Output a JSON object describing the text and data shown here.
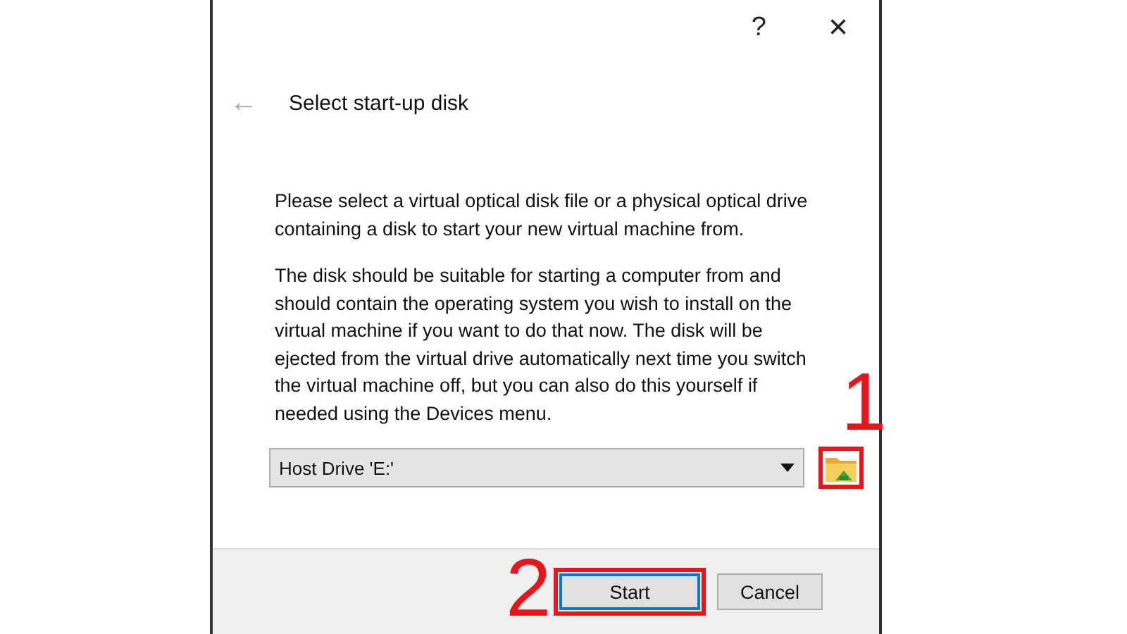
{
  "window": {
    "help_button": "?",
    "close_button": "×"
  },
  "header": {
    "back_arrow": "←",
    "title": "Select start-up disk"
  },
  "paragraphs": [
    "Please select a virtual optical disk file or a physical optical drive containing a disk to start your new virtual machine from.",
    "The disk should be suitable for starting a computer from and should contain the operating system you wish to install on the virtual machine if you want to do that now. The disk will be ejected from the virtual drive automatically next time you switch the virtual machine off, but you can also do this yourself if needed using the Devices menu."
  ],
  "disk_select": {
    "value": "Host Drive 'E:'"
  },
  "folder_button": {
    "highlighted": true,
    "step_number": "1"
  },
  "buttons": [
    {
      "label": "Start",
      "default": true,
      "highlighted": true,
      "step_number": "2"
    },
    {
      "label": "Cancel",
      "default": false,
      "highlighted": false
    }
  ]
}
